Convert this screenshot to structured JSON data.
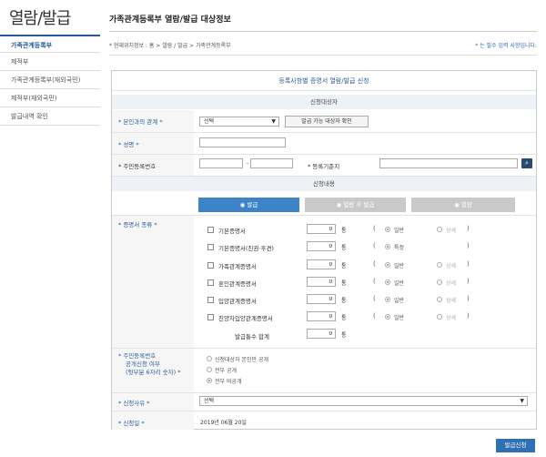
{
  "sidebar": {
    "title": "열람/발급",
    "items": [
      {
        "label": "가족관계등록부"
      },
      {
        "label": "제적부"
      },
      {
        "label": "가족관계등록부(재외국민)"
      },
      {
        "label": "제적부(재외국민)"
      },
      {
        "label": "발급내역 확인"
      }
    ]
  },
  "header": {
    "title": "가족관계등록부 열람/발급 대상정보",
    "breadcrumb": "* 현재위치정보 : 홈 > 열람 / 발급 > 가족관계등록부",
    "required_note": "* 는 필수 입력 사항입니다."
  },
  "form": {
    "title": "등록사항별 증명서 열람/발급 신청",
    "applicant_section": "신청대상자",
    "relation": {
      "label": "* 본인과의 관계 *",
      "value": "선택",
      "check_button": "발급 가능 대상자 확인"
    },
    "name": {
      "label": "* 성명 *",
      "value": ""
    },
    "rrn": {
      "label": "* 주민등록번호",
      "dash": "-",
      "first": "",
      "second": ""
    },
    "basis_place": {
      "label": "* 등록기준지",
      "value": ""
    },
    "content_section": "신청내용",
    "tabs": [
      {
        "label": "발급",
        "active": true
      },
      {
        "label": "열람 후 발급",
        "active": false
      },
      {
        "label": "열람",
        "active": false
      }
    ],
    "cert_label": "* 증명서 종류 *",
    "certs": [
      {
        "name": "기본증명서",
        "count": "0",
        "unit": "통",
        "open": "(",
        "opt1": "일반",
        "opt2": "상세",
        "close": ")"
      },
      {
        "name": "기본증명서(친권·후견)",
        "count": "0",
        "unit": "통",
        "open": "(",
        "opt1": "특정",
        "opt2": "",
        "close": ")"
      },
      {
        "name": "가족관계증명서",
        "count": "0",
        "unit": "통",
        "open": "(",
        "opt1": "일반",
        "opt2": "상세",
        "close": ")"
      },
      {
        "name": "혼인관계증명서",
        "count": "0",
        "unit": "통",
        "open": "(",
        "opt1": "일반",
        "opt2": "상세",
        "close": ")"
      },
      {
        "name": "입양관계증명서",
        "count": "0",
        "unit": "통",
        "open": "(",
        "opt1": "일반",
        "opt2": "상세",
        "close": ")"
      },
      {
        "name": "친양자입양관계증명서",
        "count": "0",
        "unit": "통",
        "open": "(",
        "opt1": "일반",
        "opt2": "상세",
        "close": ")"
      }
    ],
    "total": {
      "label": "발급통수 합계",
      "count": "0",
      "unit": "통"
    },
    "disclosure": {
      "label_lines": [
        "* 주민등록번호",
        "공개신청 여부",
        "(뒷부분 6자리 숫자) *"
      ],
      "options": [
        "신청대상자 본인만 공개",
        "전부 공개",
        "전부 비공개"
      ],
      "selected": 2
    },
    "reason": {
      "label": "* 신청사유 *",
      "value": "선택"
    },
    "date": {
      "label": "* 신청일 *",
      "value": "2019년 06월 20일"
    },
    "submit": "발급신청"
  }
}
